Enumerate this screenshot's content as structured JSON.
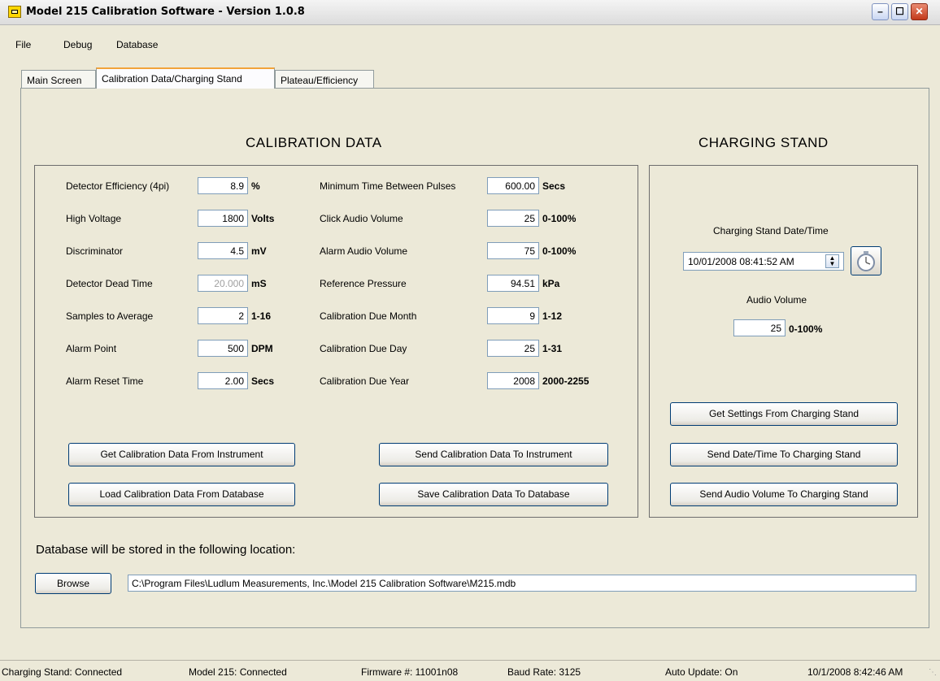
{
  "window": {
    "title": "Model 215 Calibration Software - Version 1.0.8"
  },
  "menu": [
    "File",
    "Debug",
    "Database"
  ],
  "tabs": [
    "Main Screen",
    "Calibration Data/Charging Stand",
    "Plateau/Efficiency"
  ],
  "calibration": {
    "heading": "CALIBRATION DATA",
    "left_fields": [
      {
        "label": "Detector Efficiency (4pi)",
        "value": "8.9",
        "unit": "%"
      },
      {
        "label": "High Voltage",
        "value": "1800",
        "unit": "Volts"
      },
      {
        "label": "Discriminator",
        "value": "4.5",
        "unit": "mV"
      },
      {
        "label": "Detector Dead Time",
        "value": "20.000",
        "unit": "mS",
        "disabled": true
      },
      {
        "label": "Samples to Average",
        "value": "2",
        "unit": "1-16"
      },
      {
        "label": "Alarm Point",
        "value": "500",
        "unit": "DPM"
      },
      {
        "label": "Alarm Reset Time",
        "value": "2.00",
        "unit": "Secs"
      }
    ],
    "right_fields": [
      {
        "label": "Minimum Time Between Pulses",
        "value": "600.00",
        "unit": "Secs"
      },
      {
        "label": "Click Audio Volume",
        "value": "25",
        "unit": "0-100%"
      },
      {
        "label": "Alarm Audio Volume",
        "value": "75",
        "unit": "0-100%"
      },
      {
        "label": "Reference Pressure",
        "value": "94.51",
        "unit": "kPa"
      },
      {
        "label": "Calibration Due Month",
        "value": "9",
        "unit": "1-12"
      },
      {
        "label": "Calibration Due Day",
        "value": "25",
        "unit": "1-31"
      },
      {
        "label": "Calibration Due Year",
        "value": "2008",
        "unit": "2000-2255"
      }
    ],
    "buttons": {
      "get_from_instrument": "Get Calibration  Data From Instrument",
      "send_to_instrument": "Send Calibration Data To Instrument",
      "load_from_db": "Load Calibration Data From Database",
      "save_to_db": "Save Calibration Data To Database"
    }
  },
  "charging_stand": {
    "heading": "CHARGING STAND",
    "datetime_label": "Charging Stand Date/Time",
    "datetime_value": "10/01/2008 08:41:52 AM",
    "audio_label": "Audio Volume",
    "audio_value": "25",
    "audio_unit": "0-100%",
    "buttons": {
      "get_settings": "Get Settings From Charging Stand",
      "send_datetime": "Send Date/Time To Charging Stand",
      "send_audio": "Send Audio Volume To Charging Stand"
    }
  },
  "database": {
    "location_label": "Database will be stored in the following location:",
    "browse": "Browse",
    "path": "C:\\Program Files\\Ludlum Measurements, Inc.\\Model 215 Calibration Software\\M215.mdb"
  },
  "status": {
    "charging_stand": "Charging Stand: Connected",
    "model": "Model 215: Connected",
    "firmware": "Firmware #:  11001n08",
    "baud": "Baud Rate: 3125",
    "auto_update": "Auto Update: On",
    "datetime": "10/1/2008 8:42:46 AM"
  }
}
